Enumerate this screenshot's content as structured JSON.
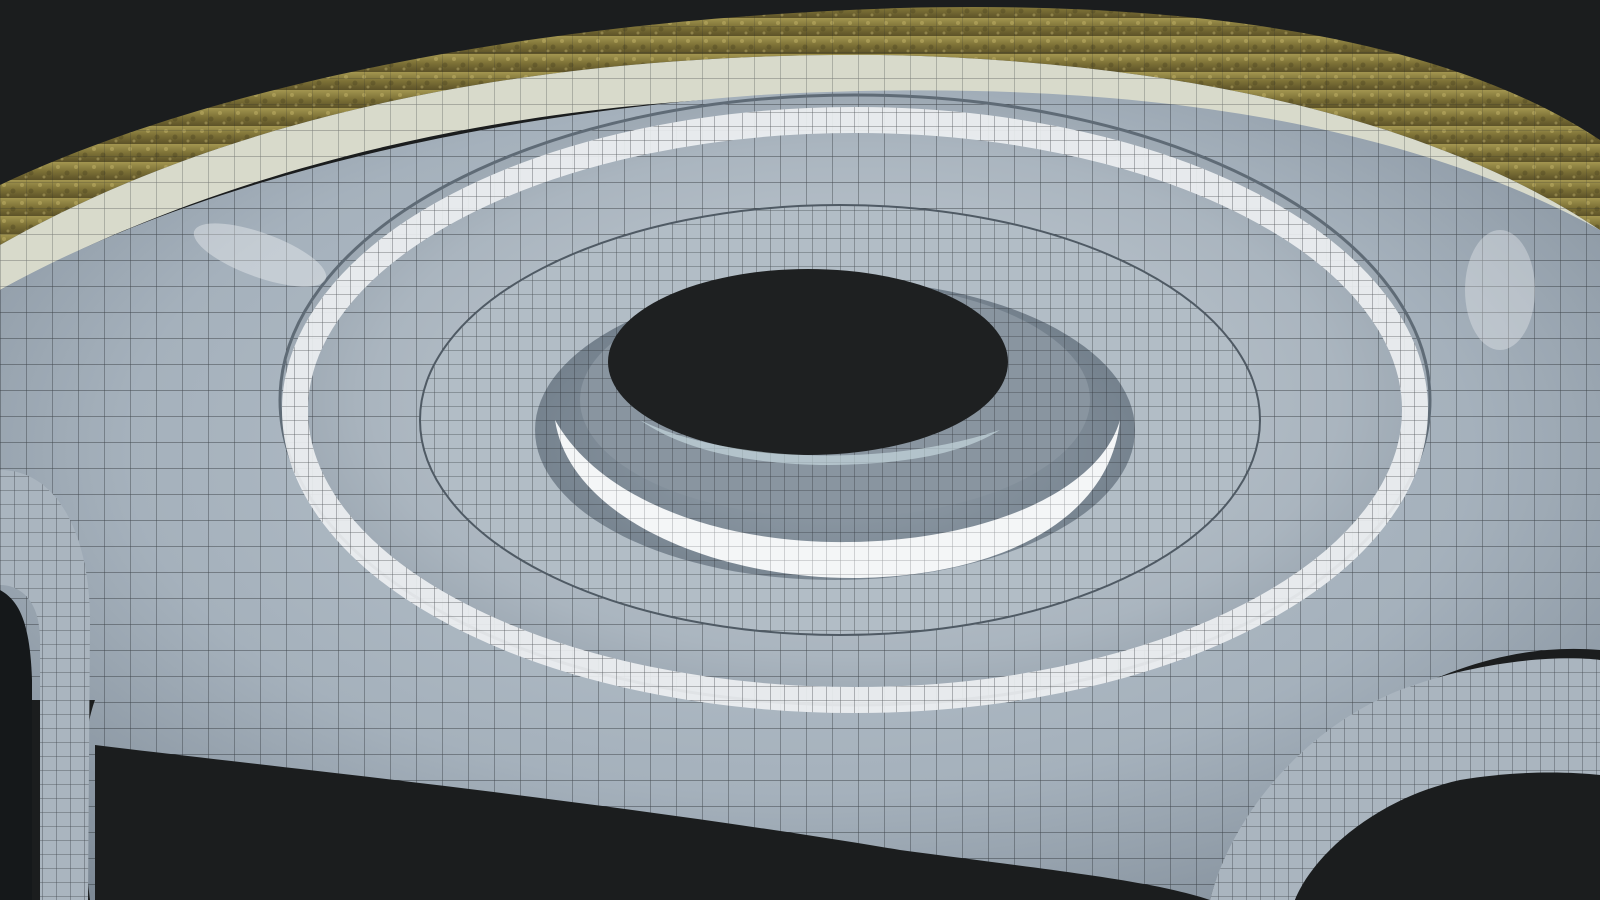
{
  "scene": {
    "subject": "wireframe-render-3d-mesh",
    "colors": {
      "background": "#1b1d1e",
      "mesh_surface": "#a9b5c0",
      "mesh_highlight": "#f4f6f7",
      "mesh_shadow": "#6f7c88",
      "wire": "#1e2326",
      "rim_cream": "#d8dacb",
      "rim_gold": "#8f8245",
      "rim_gold_dark": "#5c5228"
    }
  }
}
